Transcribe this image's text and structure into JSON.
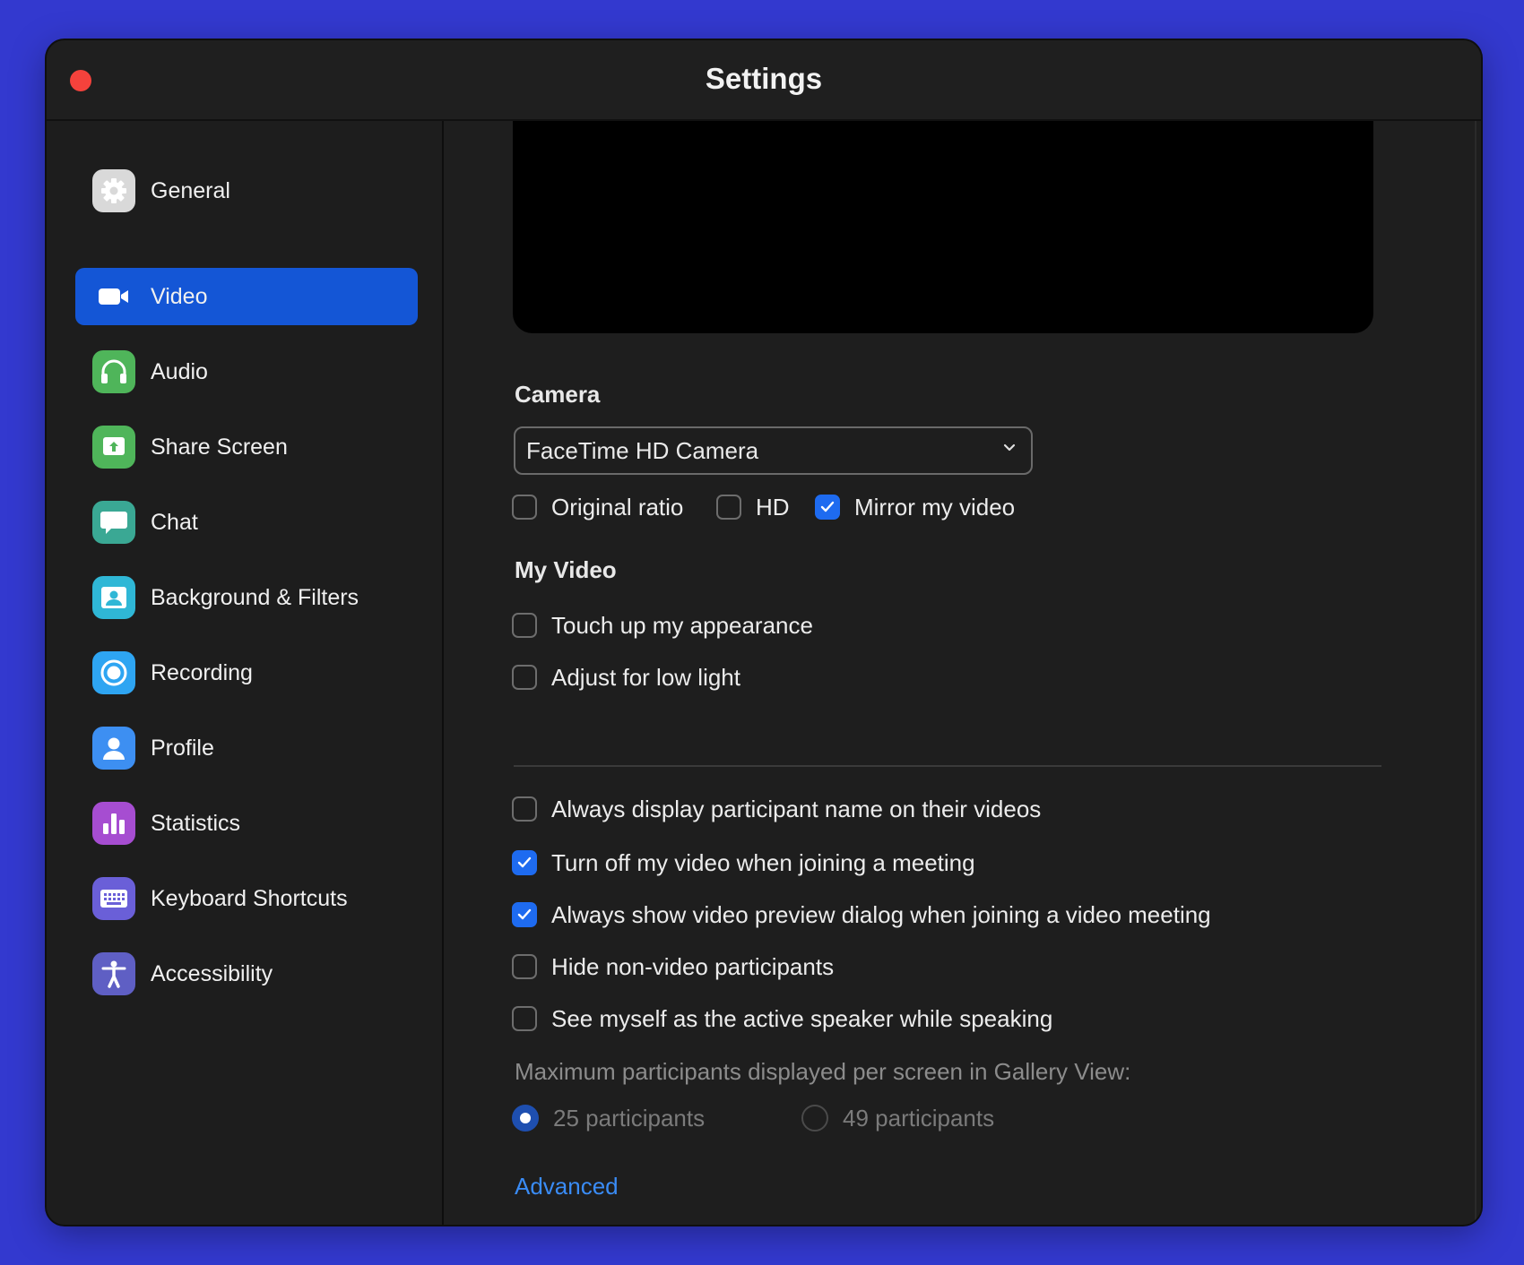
{
  "window": {
    "title": "Settings"
  },
  "sidebar": {
    "items": [
      {
        "label": "General",
        "icon": "gear-icon",
        "active": false,
        "color": "#d9d9d9"
      },
      {
        "label": "Video",
        "icon": "video-camera-icon",
        "active": true,
        "color": "#1456d6"
      },
      {
        "label": "Audio",
        "icon": "headphones-icon",
        "active": false,
        "color": "#4fb55a"
      },
      {
        "label": "Share Screen",
        "icon": "share-screen-icon",
        "active": false,
        "color": "#4fb55a"
      },
      {
        "label": "Chat",
        "icon": "chat-bubble-icon",
        "active": false,
        "color": "#3aa894"
      },
      {
        "label": "Background & Filters",
        "icon": "background-person-icon",
        "active": false,
        "color": "#2fb7d6"
      },
      {
        "label": "Recording",
        "icon": "record-icon",
        "active": false,
        "color": "#2ea5f2"
      },
      {
        "label": "Profile",
        "icon": "profile-icon",
        "active": false,
        "color": "#3d8ff2"
      },
      {
        "label": "Statistics",
        "icon": "bar-chart-icon",
        "active": false,
        "color": "#a64dd1"
      },
      {
        "label": "Keyboard Shortcuts",
        "icon": "keyboard-icon",
        "active": false,
        "color": "#6a5fd8"
      },
      {
        "label": "Accessibility",
        "icon": "accessibility-icon",
        "active": false,
        "color": "#5f5fc4"
      }
    ]
  },
  "video": {
    "camera_title": "Camera",
    "camera_select": "FaceTime HD Camera",
    "camera_options": [
      {
        "label": "Original ratio",
        "checked": false
      },
      {
        "label": "HD",
        "checked": false
      },
      {
        "label": "Mirror my video",
        "checked": true
      }
    ],
    "my_video_title": "My Video",
    "my_video_options": [
      {
        "label": "Touch up my appearance",
        "checked": false
      },
      {
        "label": "Adjust for low light",
        "checked": false
      }
    ],
    "general_options": [
      {
        "label": "Always display participant name on their videos",
        "checked": false
      },
      {
        "label": "Turn off my video when joining a meeting",
        "checked": true
      },
      {
        "label": "Always show video preview dialog when joining a video meeting",
        "checked": true
      },
      {
        "label": "Hide non-video participants",
        "checked": false
      },
      {
        "label": "See myself as the active speaker while speaking",
        "checked": false
      }
    ],
    "gallery_label": "Maximum participants displayed per screen in Gallery View:",
    "gallery_options": [
      {
        "label": "25 participants",
        "selected": true
      },
      {
        "label": "49 participants",
        "selected": false
      }
    ],
    "advanced_link": "Advanced"
  },
  "colors": {
    "accent": "#1456d6",
    "checkbox_checked": "#1e6bf0",
    "link": "#3a8cf6",
    "close": "#f5423c",
    "background": "#3339cf"
  }
}
